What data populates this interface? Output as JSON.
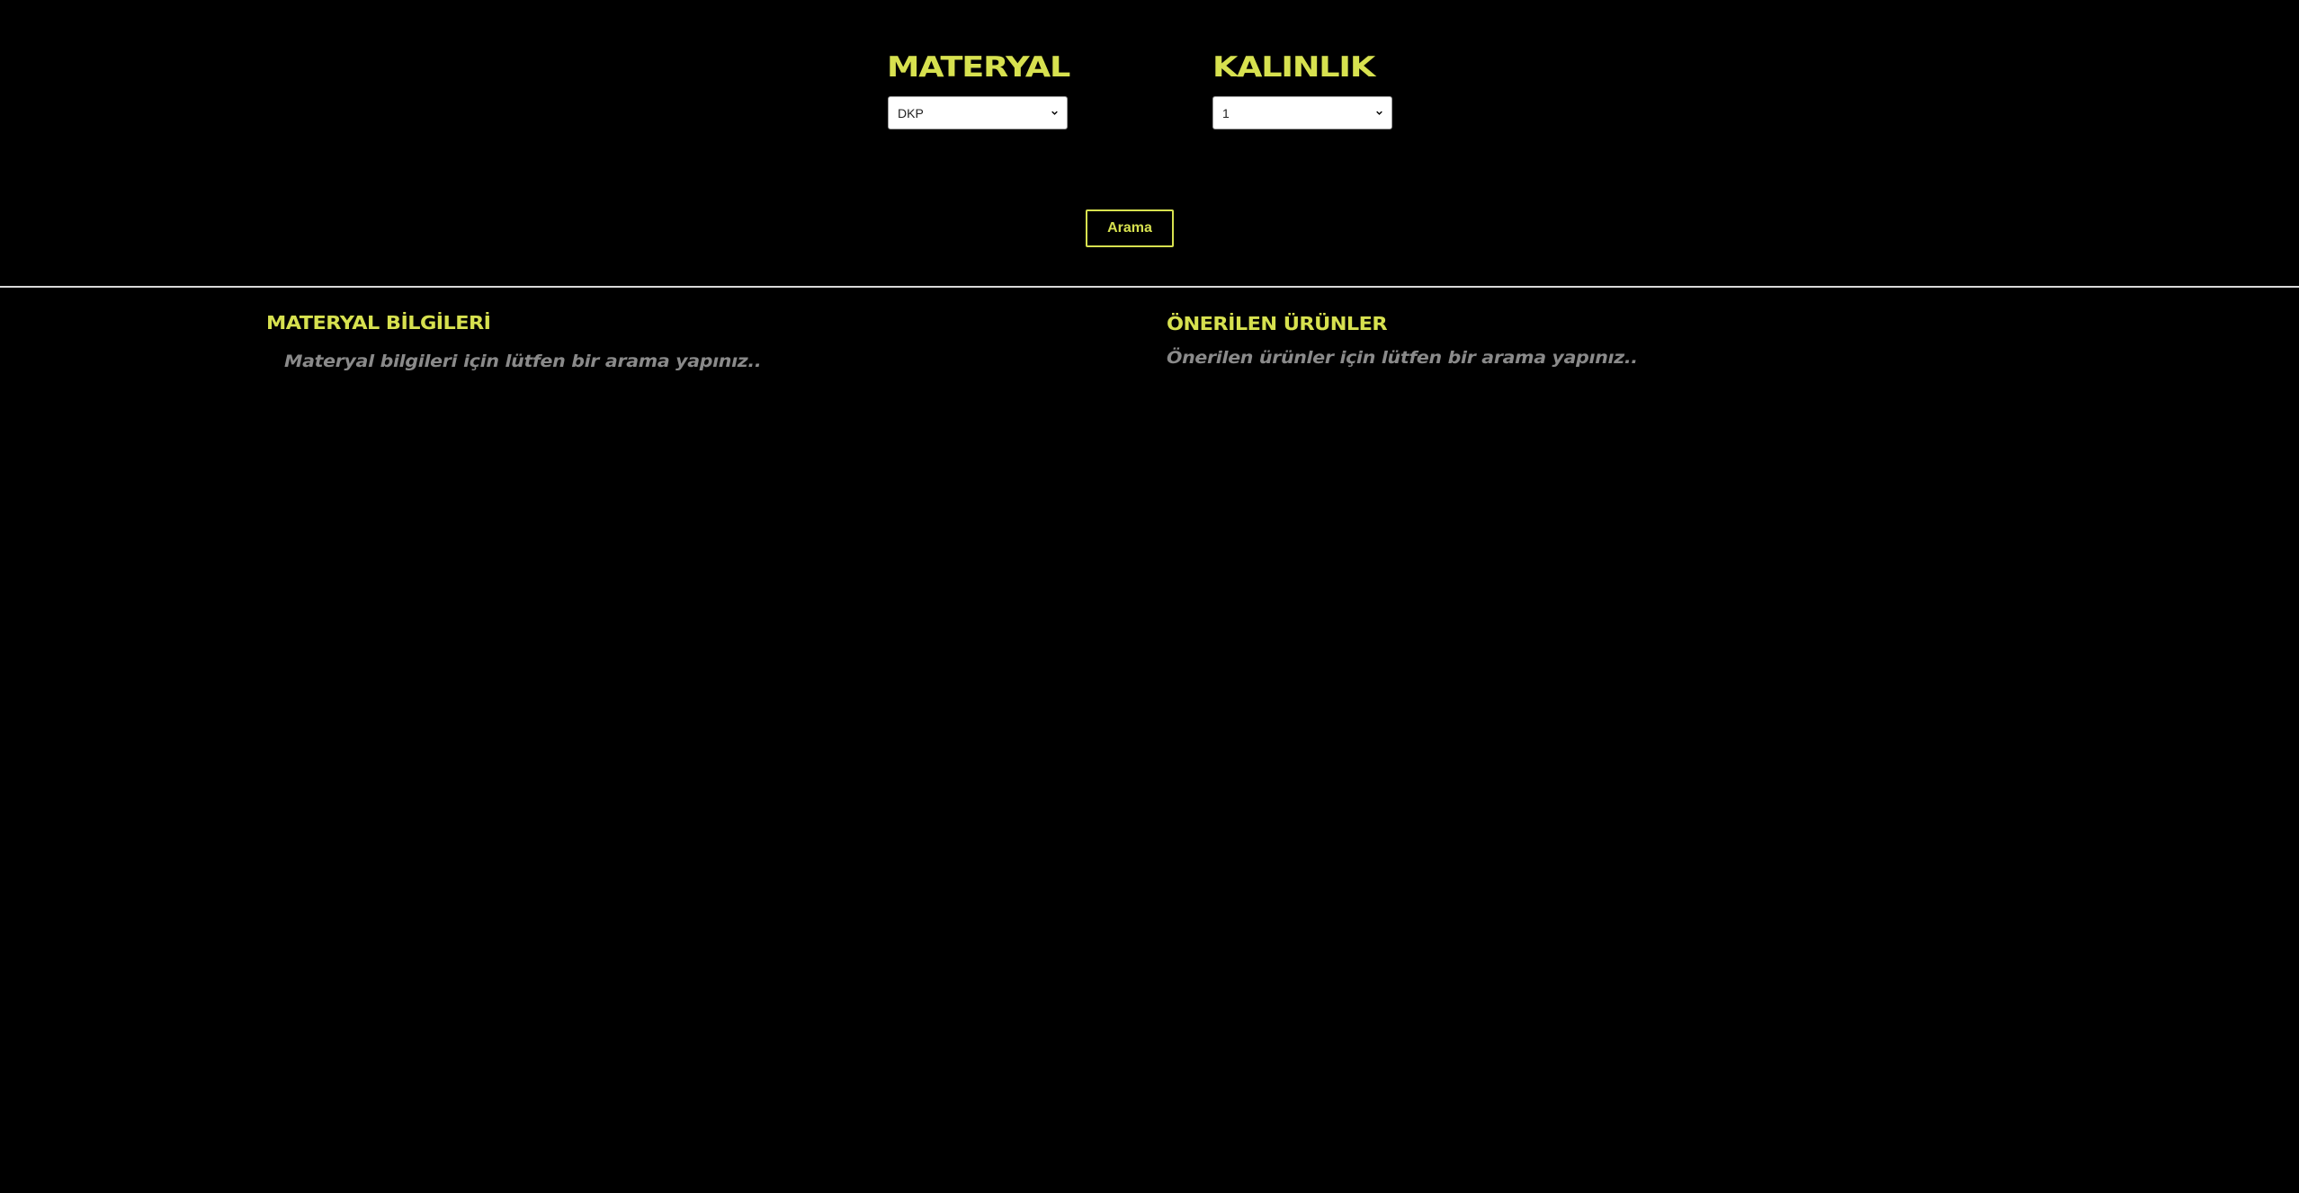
{
  "colors": {
    "background": "#000000",
    "accent": "#d7e14f",
    "muted_text": "#8a8a8a",
    "divider": "#d9d9d9"
  },
  "filters": {
    "material": {
      "label": "MATERYAL",
      "selected_value": "DKP"
    },
    "thickness": {
      "label": "KALINLIK",
      "selected_value": "1"
    }
  },
  "search_button": {
    "label": "Arama"
  },
  "material_info": {
    "title": "MATERYAL BİLGİLERİ",
    "empty_message": "Materyal bilgileri için lütfen bir arama yapınız.."
  },
  "recommended_products": {
    "title": "ÖNERİLEN ÜRÜNLER",
    "empty_message": "Önerilen ürünler için lütfen bir arama yapınız.."
  },
  "icons": {
    "select_chevron": "chevron-down-icon"
  }
}
